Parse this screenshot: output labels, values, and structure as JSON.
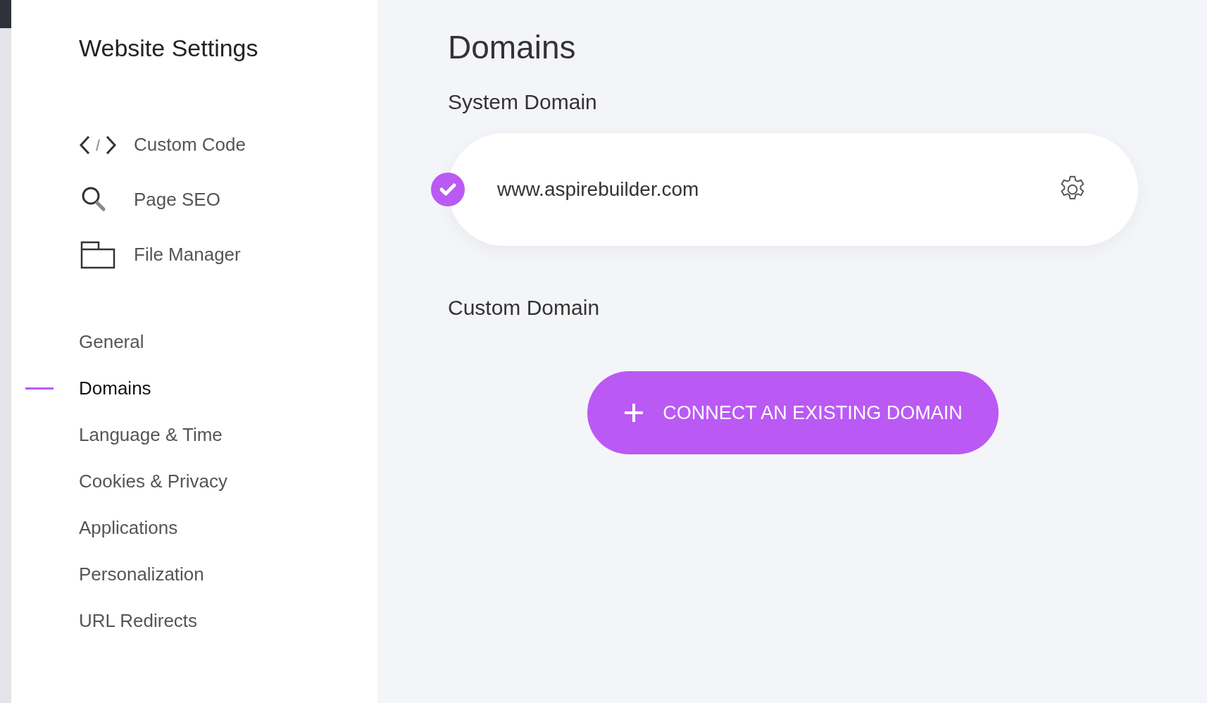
{
  "sidebar": {
    "title": "Website Settings",
    "tools": [
      {
        "label": "Custom Code",
        "kind": "code"
      },
      {
        "label": "Page SEO",
        "kind": "search"
      },
      {
        "label": "File Manager",
        "kind": "folder"
      }
    ],
    "nav": [
      {
        "label": "General",
        "selected": false
      },
      {
        "label": "Domains",
        "selected": true
      },
      {
        "label": "Language & Time",
        "selected": false
      },
      {
        "label": "Cookies & Privacy",
        "selected": false
      },
      {
        "label": "Applications",
        "selected": false
      },
      {
        "label": "Personalization",
        "selected": false
      },
      {
        "label": "URL Redirects",
        "selected": false
      }
    ]
  },
  "main": {
    "title": "Domains",
    "system_domain": {
      "heading": "System Domain",
      "domain": "www.aspirebuilder.com",
      "verified": true
    },
    "custom_domain": {
      "heading": "Custom Domain",
      "button": "CONNECT AN EXISTING DOMAIN"
    }
  }
}
